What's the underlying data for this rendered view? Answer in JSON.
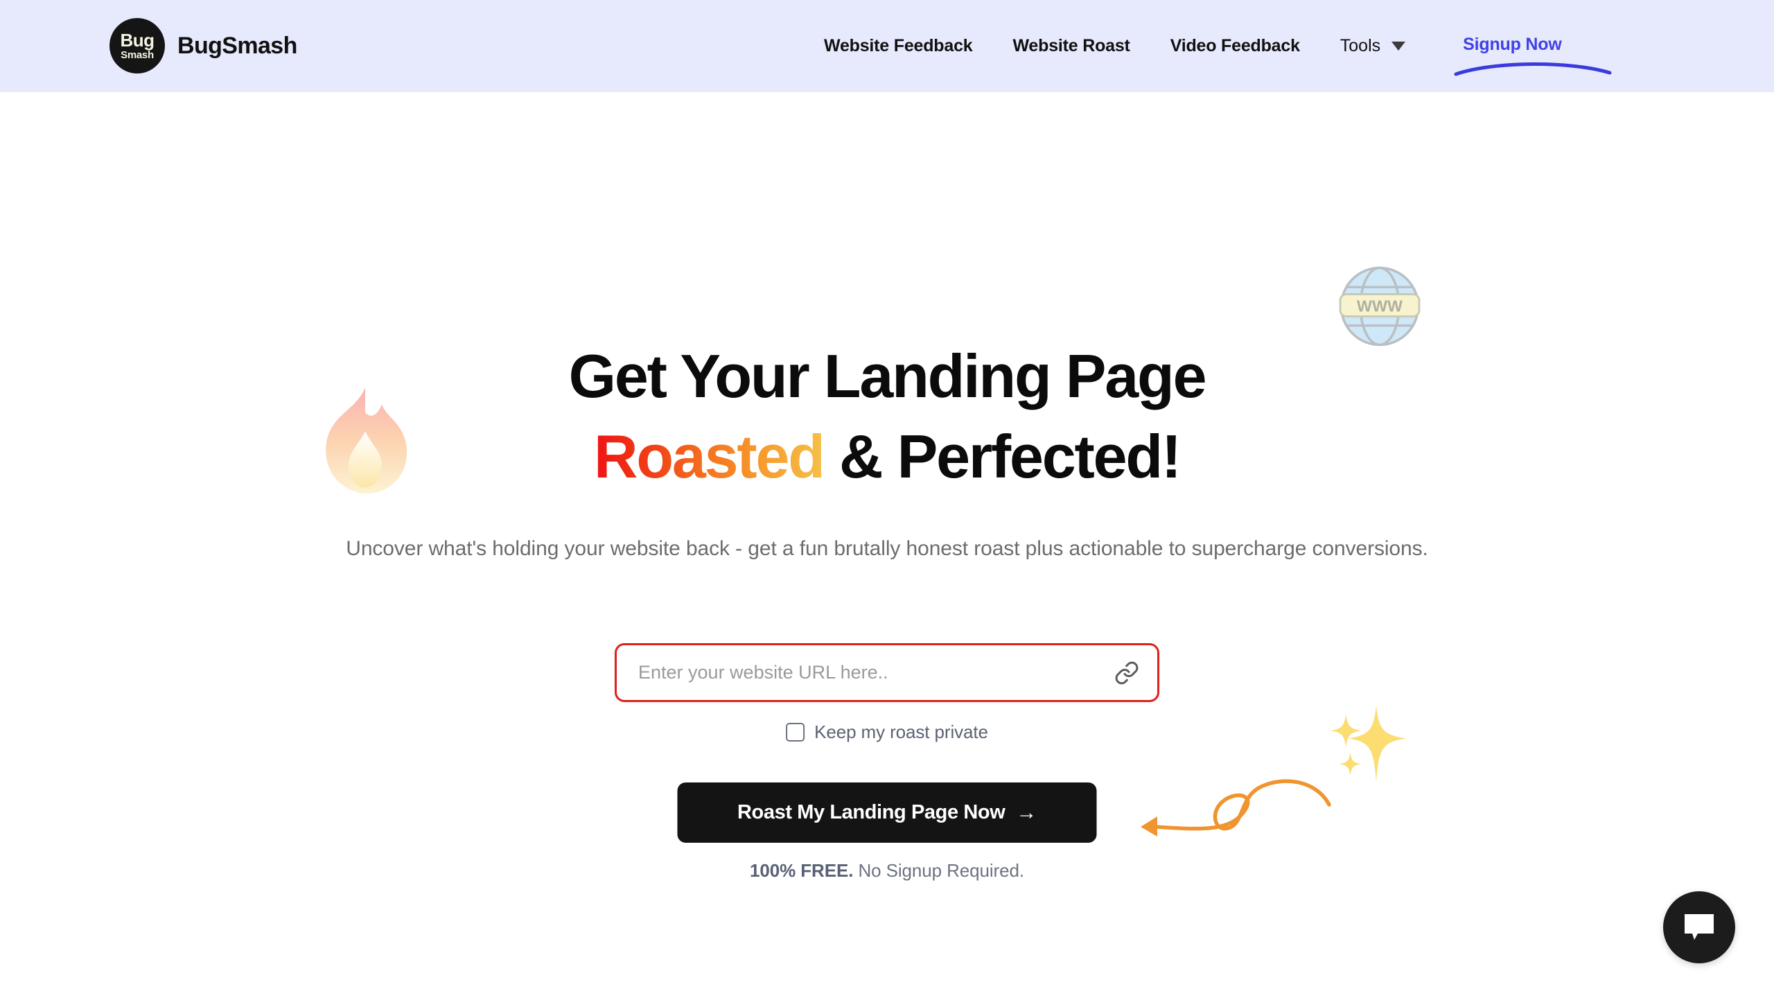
{
  "header": {
    "logo": {
      "icon": "bugsmash-logo-icon",
      "line1": "Bug",
      "line2": "Smash"
    },
    "brand_name": "BugSmash",
    "background_color": "#e7eafd",
    "nav_items": [
      {
        "label": "Website Feedback",
        "name": "nav-website-feedback"
      },
      {
        "label": "Website Roast",
        "name": "nav-website-roast"
      },
      {
        "label": "Video Feedback",
        "name": "nav-video-feedback"
      }
    ],
    "tools": {
      "label": "Tools",
      "caret_icon": "chevron-down-icon"
    },
    "signup": {
      "label": "Signup Now",
      "color": "#4040e8"
    }
  },
  "hero": {
    "headline_line1": "Get Your Landing Page",
    "headline_highlight": "Roasted",
    "headline_rest": " & Perfected!",
    "highlight_gradient_from": "#f01313",
    "highlight_gradient_to": "#f6c049",
    "subhead_line1": "Uncover what's holding your website back - get a fun brutally honest roast plus actionable",
    "subhead_line2": "to supercharge conversions.",
    "url_input": {
      "value": "",
      "placeholder": "Enter your website URL here..",
      "border_color": "#e0201b",
      "icon": "link-icon"
    },
    "privacy": {
      "label": "Keep my roast private",
      "checked": false
    },
    "cta": {
      "label": "Roast My Landing Page Now",
      "arrow": "→",
      "background_color": "#141414"
    },
    "free_note_strong": "100% FREE.",
    "free_note_rest": " No Signup Required.",
    "decorations": {
      "globe": {
        "icon": "globe-www-icon",
        "text": "WWW"
      },
      "flame": {
        "icon": "flame-icon"
      },
      "sparkles": {
        "icon": "sparkles-icon"
      },
      "arrow": {
        "icon": "curly-arrow-icon"
      }
    }
  },
  "chat_widget": {
    "icon": "chat-bubble-icon"
  }
}
